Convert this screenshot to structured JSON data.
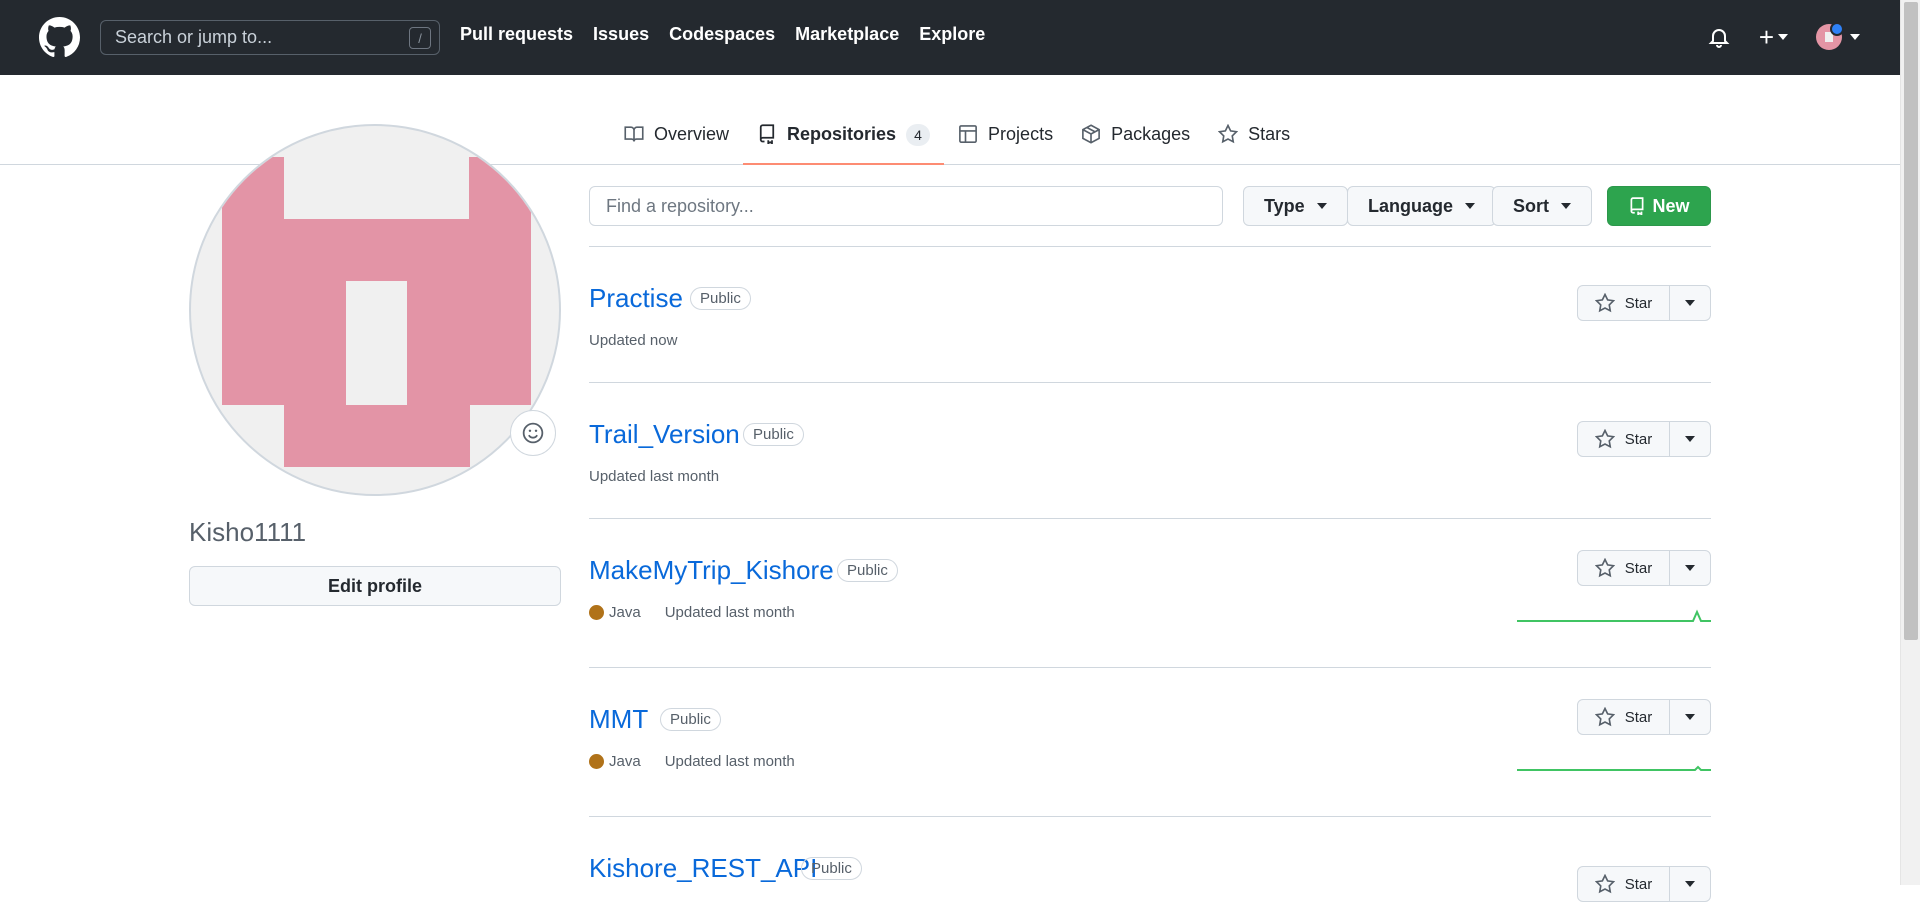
{
  "header": {
    "search_placeholder": "Search or jump to...",
    "search_shortcut": "/",
    "nav": [
      "Pull requests",
      "Issues",
      "Codespaces",
      "Marketplace",
      "Explore"
    ],
    "plus_label": "+"
  },
  "tabs": [
    {
      "label": "Overview",
      "icon": "book-icon"
    },
    {
      "label": "Repositories",
      "icon": "repo-icon",
      "count": "4"
    },
    {
      "label": "Projects",
      "icon": "table-icon"
    },
    {
      "label": "Packages",
      "icon": "package-icon"
    },
    {
      "label": "Stars",
      "icon": "star-icon"
    }
  ],
  "profile": {
    "username": "Kisho1111",
    "edit_label": "Edit profile"
  },
  "filters": {
    "find_placeholder": "Find a repository...",
    "type_label": "Type",
    "language_label": "Language",
    "sort_label": "Sort",
    "new_label": "New"
  },
  "repos": [
    {
      "name": "Practise",
      "visibility": "Public",
      "language": "",
      "updated": "Updated now",
      "star_label": "Star"
    },
    {
      "name": "Trail_Version",
      "visibility": "Public",
      "language": "",
      "updated": "Updated last month",
      "star_label": "Star"
    },
    {
      "name": "MakeMyTrip_Kishore",
      "visibility": "Public",
      "language": "Java",
      "updated": "Updated last month",
      "star_label": "Star"
    },
    {
      "name": "MMT",
      "visibility": "Public",
      "language": "Java",
      "updated": "Updated last month",
      "star_label": "Star"
    },
    {
      "name": "Kishore_REST_API",
      "visibility": "Public",
      "language": "",
      "updated": "",
      "star_label": "Star"
    }
  ],
  "colors": {
    "header_bg": "#24292f",
    "link": "#0969da",
    "new_button": "#2da44e",
    "java": "#b07219",
    "tab_underline": "#fd8c73",
    "avatar_pink": "#e394a6"
  }
}
